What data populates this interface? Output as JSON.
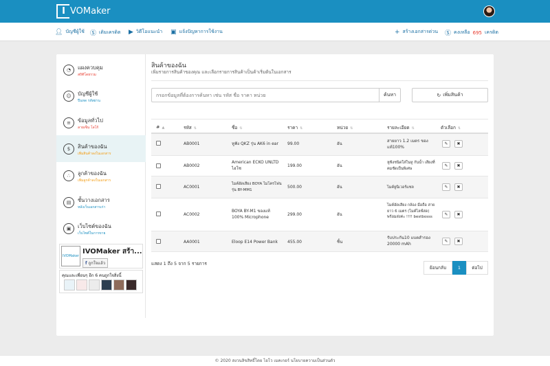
{
  "app": {
    "logo_text": "IVOMaker",
    "logo_letter": "I"
  },
  "subnav": {
    "left": [
      {
        "label": "บัญชีผู้ใช้",
        "icon": "user-icon"
      },
      {
        "label": "เติมเครดิต",
        "icon": "dollar-icon"
      },
      {
        "label": "วิดีโอแนะนำ",
        "icon": "video-icon"
      },
      {
        "label": "แจ้งปัญหาการใช้งาน",
        "icon": "id-card-icon"
      }
    ],
    "quick_doc": "สร้างเอกสารด่วน",
    "credit_label": "คงเหลือ",
    "credit_value": "695",
    "credit_unit": "เครดิต"
  },
  "sidebar": {
    "items": [
      {
        "title": "แผงควบคุม",
        "sub": "สถิติโดยรวม",
        "sub_color": "#e8392c",
        "icon": "dashboard-icon"
      },
      {
        "title": "บัญชีผู้ใช้",
        "sub": "ปีนหด รหัสผ่าน",
        "sub_color": "#1a8fc1",
        "icon": "users-icon"
      },
      {
        "title": "ข้อมูลทั่วไป",
        "sub": "ลายเซ็น โลโก้",
        "sub_color": "#e8392c",
        "icon": "database-icon"
      },
      {
        "title": "สินค้าของฉัน",
        "sub": "เพิ่มสินค้าลงในเอกสาร",
        "sub_color": "#f39c12",
        "icon": "product-icon"
      },
      {
        "title": "ลูกค้าของฉัน",
        "sub": "เพิ่มลูกค้าลงในเอกสาร",
        "sub_color": "#f39c12",
        "icon": "customers-icon"
      },
      {
        "title": "ชั้นวางเอกสาร",
        "sub": "หลังเว็บเอกสารเก่า",
        "sub_color": "#1a8fc1",
        "icon": "shelf-icon"
      },
      {
        "title": "เว็บไซต์ของฉัน",
        "sub": "เว็บไซต์ในการขาย",
        "sub_color": "#1a8fc1",
        "icon": "website-icon"
      }
    ],
    "fb_page_name": "IVOMaker สร้า...",
    "fb_like": "ถูกใจแล้ว",
    "fb_thumb_text": "IVOMaker",
    "fb_friends": "คุณและเพื่อนๆ อีก 6 คนถูกใจสิ่งนี้"
  },
  "main": {
    "title": "สินค้าของฉัน",
    "subtitle": "เพิ่มรายการสินค้าของคุณ และเลือกรายการสินค้าเป็นค้าเริ่มต้นในเอกสาร",
    "search_placeholder": "กรอกข้อมูลที่ต้องการค้นหา เช่น รหัส ชื่อ ราคา หน่วย",
    "search_button": "ค้นหา",
    "add_button": "เพิ่มสินค้า"
  },
  "table": {
    "headers": [
      "#",
      "รหัส",
      "ชื่อ",
      "ราคา",
      "หน่วย",
      "รายละเอียด",
      "ตัวเลือก"
    ],
    "rows": [
      {
        "code": "AB0001",
        "name": "หูฟัง QKZ รุ่น AK6 in ear",
        "price": "99.00",
        "unit": "อัน",
        "detail": "สายยาว 1.2 เมตร ของแท้100%"
      },
      {
        "code": "AB0002",
        "name": "American ECKO UNLTD ไฮโซ",
        "price": "199.00",
        "unit": "อัน",
        "detail": "หูฟังชนิดใส่ในหู กันน้ำ เสียงที่คมชัดเป็นพิเศษ"
      },
      {
        "code": "AC0001",
        "name": "ไมค์อัดเสียง BOYA ไมโครโฟน รุ่น BY-MM1",
        "price": "500.00",
        "unit": "อัน",
        "detail": "ไมค์ยูนิเวอร์แซล"
      },
      {
        "code": "AC0002",
        "name": "BOYA BY-M1 ของแท้ 100% Microphone",
        "price": "299.00",
        "unit": "อัน",
        "detail": "ไมค์อัดเสียง กล้อง มือถือ สายยาว 6 เมตร (ไมค์ไลฟ์สด) พร้อมส่งค่ะ !!!! bestbosss"
      },
      {
        "code": "AA0001",
        "name": "Eloop E14 Power Bank",
        "price": "455.00",
        "unit": "ชิ้น",
        "detail": "รับประกัน10 แบตสำรอง 20000 mAh"
      }
    ]
  },
  "pagination": {
    "info": "แสดง 1 ถึง 5 จาก 5 รายการ",
    "prev": "ย้อนกลับ",
    "current": "1",
    "next": "ต่อไป"
  },
  "footer": {
    "text": "© 2020 สงวนลิขสิทธิ์โดย ไอโว เมคเกอร์ นโยบายความเป็นส่วนตัว"
  },
  "colors": {
    "brand": "#1a8fc1",
    "credit": "#e8392c",
    "active_side": "#e8f3f5"
  }
}
